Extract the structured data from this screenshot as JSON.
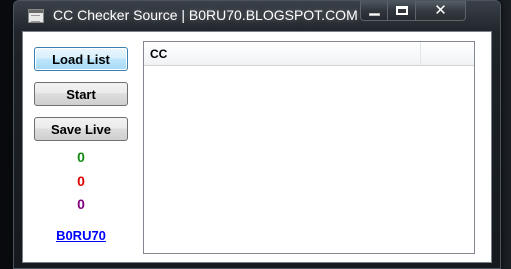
{
  "window": {
    "title": "CC Checker Source | B0RU70.BLOGSPOT.COM",
    "icon": "app-window-icon"
  },
  "caption_buttons": {
    "minimize_icon": "minimize-icon",
    "maximize_icon": "maximize-icon",
    "close_glyph": "✕"
  },
  "buttons": {
    "load_list": "Load List",
    "start": "Start",
    "save_live": "Save Live"
  },
  "counters": {
    "live": "0",
    "dead": "0",
    "unknown": "0"
  },
  "link": {
    "label": "B0RU70"
  },
  "listview": {
    "columns": [
      "CC",
      ""
    ],
    "rows": []
  },
  "colors": {
    "live": "#138a13",
    "dead": "#e00000",
    "unknown": "#800080",
    "link": "#0000ff"
  }
}
